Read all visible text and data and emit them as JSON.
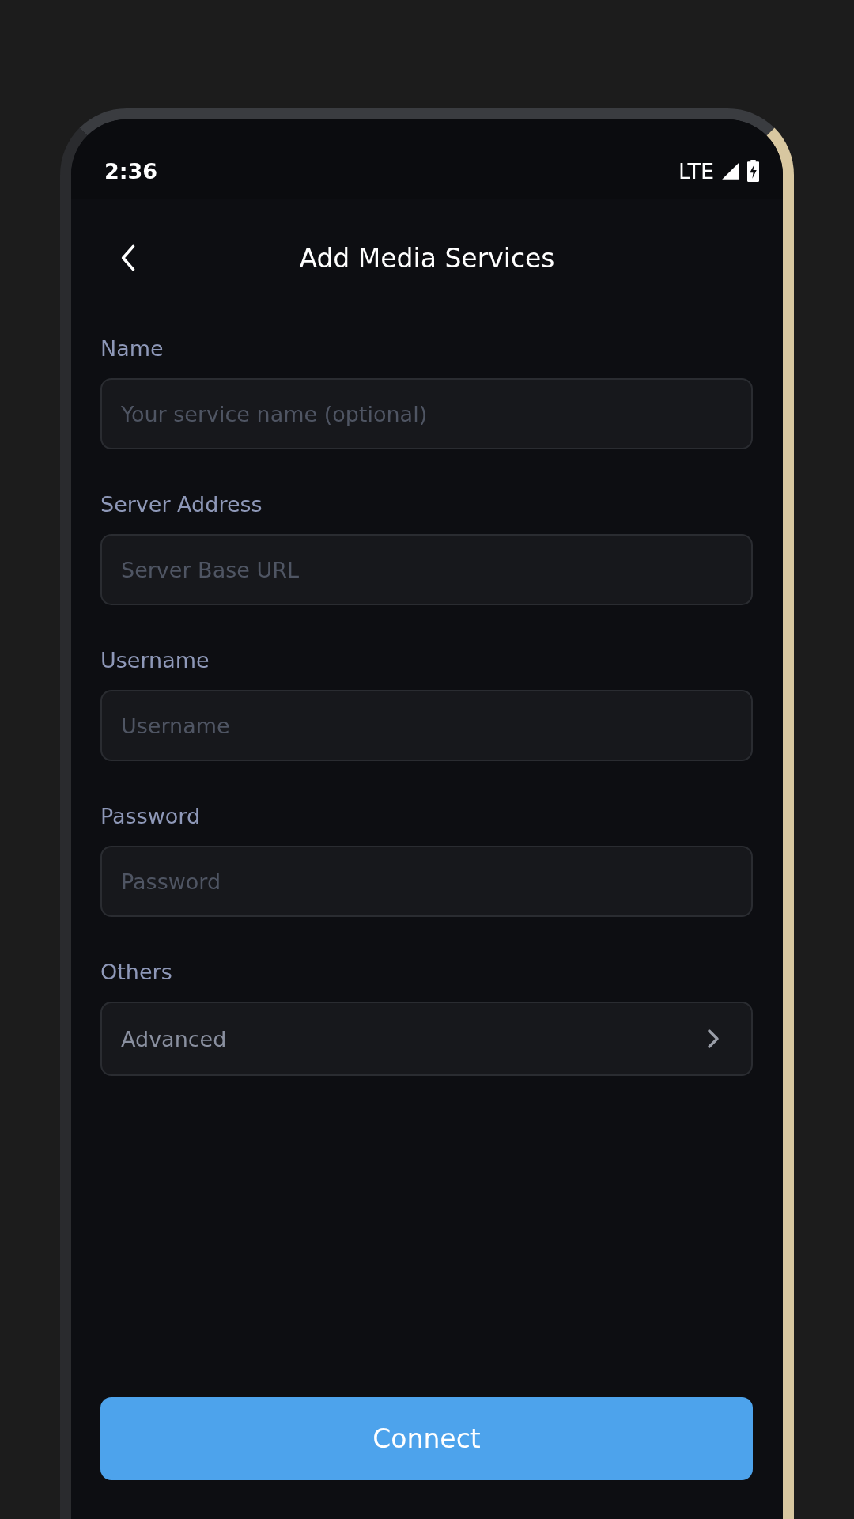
{
  "status_bar": {
    "time": "2:36",
    "network": "LTE"
  },
  "header": {
    "title": "Add Media Services"
  },
  "sections": [
    {
      "label": "Name",
      "kind": "input",
      "placeholder": "Your service name (optional)"
    },
    {
      "label": "Server Address",
      "kind": "input",
      "placeholder": "Server Base URL"
    },
    {
      "label": "Username",
      "kind": "input",
      "placeholder": "Username"
    },
    {
      "label": "Password",
      "kind": "input",
      "placeholder": "Password"
    },
    {
      "label": "Others",
      "kind": "link",
      "value": "Advanced"
    }
  ],
  "connect_button": {
    "label": "Connect"
  }
}
